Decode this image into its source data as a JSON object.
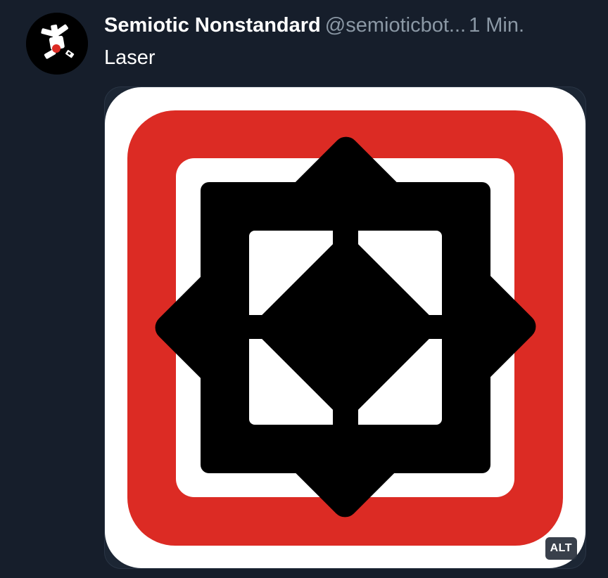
{
  "post": {
    "display_name": "Semiotic Nonstandard",
    "handle": "@semioticbot...",
    "time": "1 Min.",
    "text": "Laser"
  },
  "media": {
    "alt_badge": "ALT",
    "image_icon": "laser-hazard-symbol-icon"
  },
  "avatar": {
    "icon": "semiotic-logo-icon"
  },
  "colors": {
    "background": "#161e2b",
    "sign_red": "#dc2b24",
    "sign_white": "#ffffff",
    "sign_black": "#000000",
    "muted_text": "#8b98a5"
  }
}
